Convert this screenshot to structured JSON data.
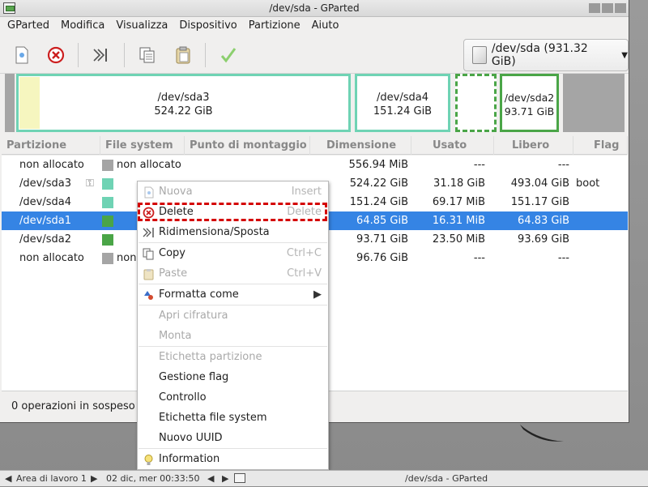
{
  "window": {
    "title": "/dev/sda - GParted"
  },
  "menubar": [
    "GParted",
    "Modifica",
    "Visualizza",
    "Dispositivo",
    "Partizione",
    "Aiuto"
  ],
  "toolbar": {
    "icons": [
      "new-partition-icon",
      "delete-partition-icon",
      "resize-move-icon",
      "copy-icon",
      "paste-icon",
      "apply-icon"
    ]
  },
  "device_selector": {
    "label": "/dev/sda (931.32 GiB)"
  },
  "partition_map": [
    {
      "name": "/dev/sda3",
      "size": "524.22 GiB",
      "color": "#6fd3b4"
    },
    {
      "name": "/dev/sda4",
      "size": "151.24 GiB",
      "color": "#6fd3b4"
    },
    {
      "name": "/dev/sda2",
      "size": "93.71 GiB",
      "color": "#4aa547"
    }
  ],
  "columns": [
    "Partizione",
    "File system",
    "Punto di montaggio",
    "Dimensione",
    "Usato",
    "Libero",
    "Flag"
  ],
  "rows": [
    {
      "partition": "non allocato",
      "fs": "non allocato",
      "mount": "",
      "size": "556.94 MiB",
      "used": "---",
      "free": "---",
      "flags": ""
    },
    {
      "partition": "/dev/sda3",
      "fs": "",
      "mount": "",
      "size": "524.22 GiB",
      "used": "31.18 GiB",
      "free": "493.04 GiB",
      "flags": "boot"
    },
    {
      "partition": "/dev/sda4",
      "fs": "",
      "mount": "",
      "size": "151.24 GiB",
      "used": "69.17 MiB",
      "free": "151.17 GiB",
      "flags": ""
    },
    {
      "partition": "/dev/sda1",
      "fs": "",
      "mount": "",
      "size": "64.85 GiB",
      "used": "16.31 MiB",
      "free": "64.83 GiB",
      "flags": ""
    },
    {
      "partition": "/dev/sda2",
      "fs": "",
      "mount": "",
      "size": "93.71 GiB",
      "used": "23.50 MiB",
      "free": "93.69 GiB",
      "flags": ""
    },
    {
      "partition": "non allocato",
      "fs": "non",
      "mount": "",
      "size": "96.76 GiB",
      "used": "---",
      "free": "---",
      "flags": ""
    }
  ],
  "status": "0 operazioni in sospeso",
  "context_menu": {
    "nuova": {
      "label": "Nuova",
      "accel": "Insert"
    },
    "delete": {
      "label": "Delete",
      "accel": "Delete"
    },
    "resize": {
      "label": "Ridimensiona/Sposta"
    },
    "copy": {
      "label": "Copy",
      "accel": "Ctrl+C"
    },
    "paste": {
      "label": "Paste",
      "accel": "Ctrl+V"
    },
    "format": {
      "label": "Formatta come"
    },
    "open_encryption": {
      "label": "Apri cifratura"
    },
    "mount": {
      "label": "Monta"
    },
    "partition_label": {
      "label": "Etichetta partizione"
    },
    "manage_flags": {
      "label": "Gestione flag"
    },
    "check": {
      "label": "Controllo"
    },
    "fs_label": {
      "label": "Etichetta file system"
    },
    "new_uuid": {
      "label": "Nuovo UUID"
    },
    "information": {
      "label": "Information"
    }
  },
  "taskbar": {
    "workspace": "Area di lavoro 1",
    "datetime": "02 dic, mer 00:33:50",
    "task": "/dev/sda - GParted"
  }
}
